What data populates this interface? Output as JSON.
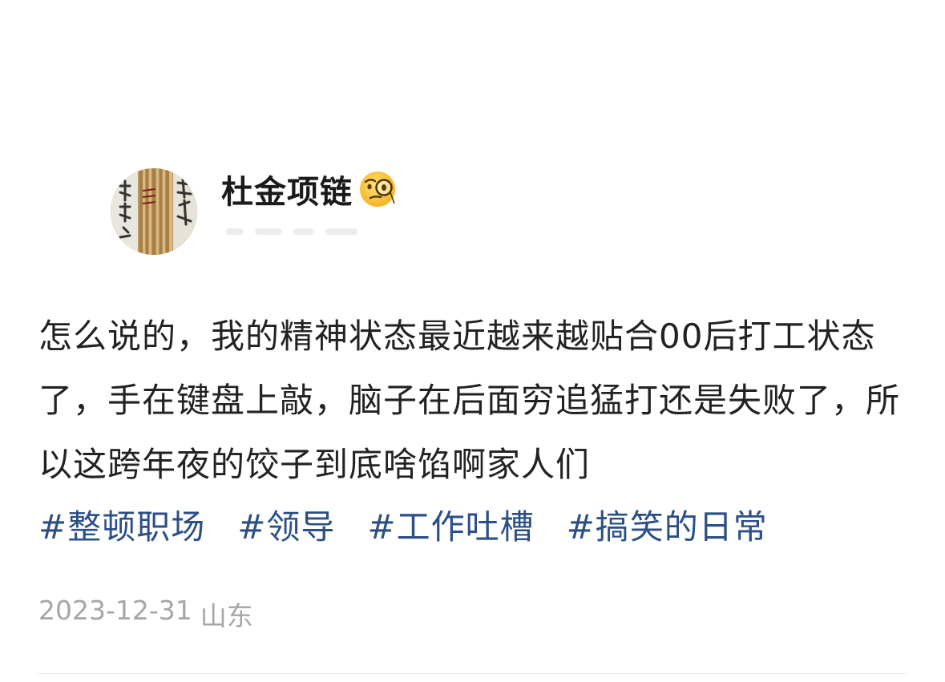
{
  "author": {
    "name": "杜金项链",
    "badge_icon": "monocle-face-icon",
    "avatar_icon": "calligraphy-scroll-avatar"
  },
  "post": {
    "text": "怎么说的，我的精神状态最近越来越贴合00后打工状态了，手在键盘上敲，脑子在后面穷追猛打还是失败了，所以这跨年夜的饺子到底啥馅啊家人们",
    "tags": [
      "#整顿职场",
      "#领导",
      "#工作吐槽",
      "#搞笑的日常"
    ]
  },
  "meta": {
    "date": "2023-12-31",
    "location": "山东"
  },
  "colors": {
    "tag": "#2b4f86",
    "text": "#222222",
    "meta": "#a6a6a6"
  }
}
